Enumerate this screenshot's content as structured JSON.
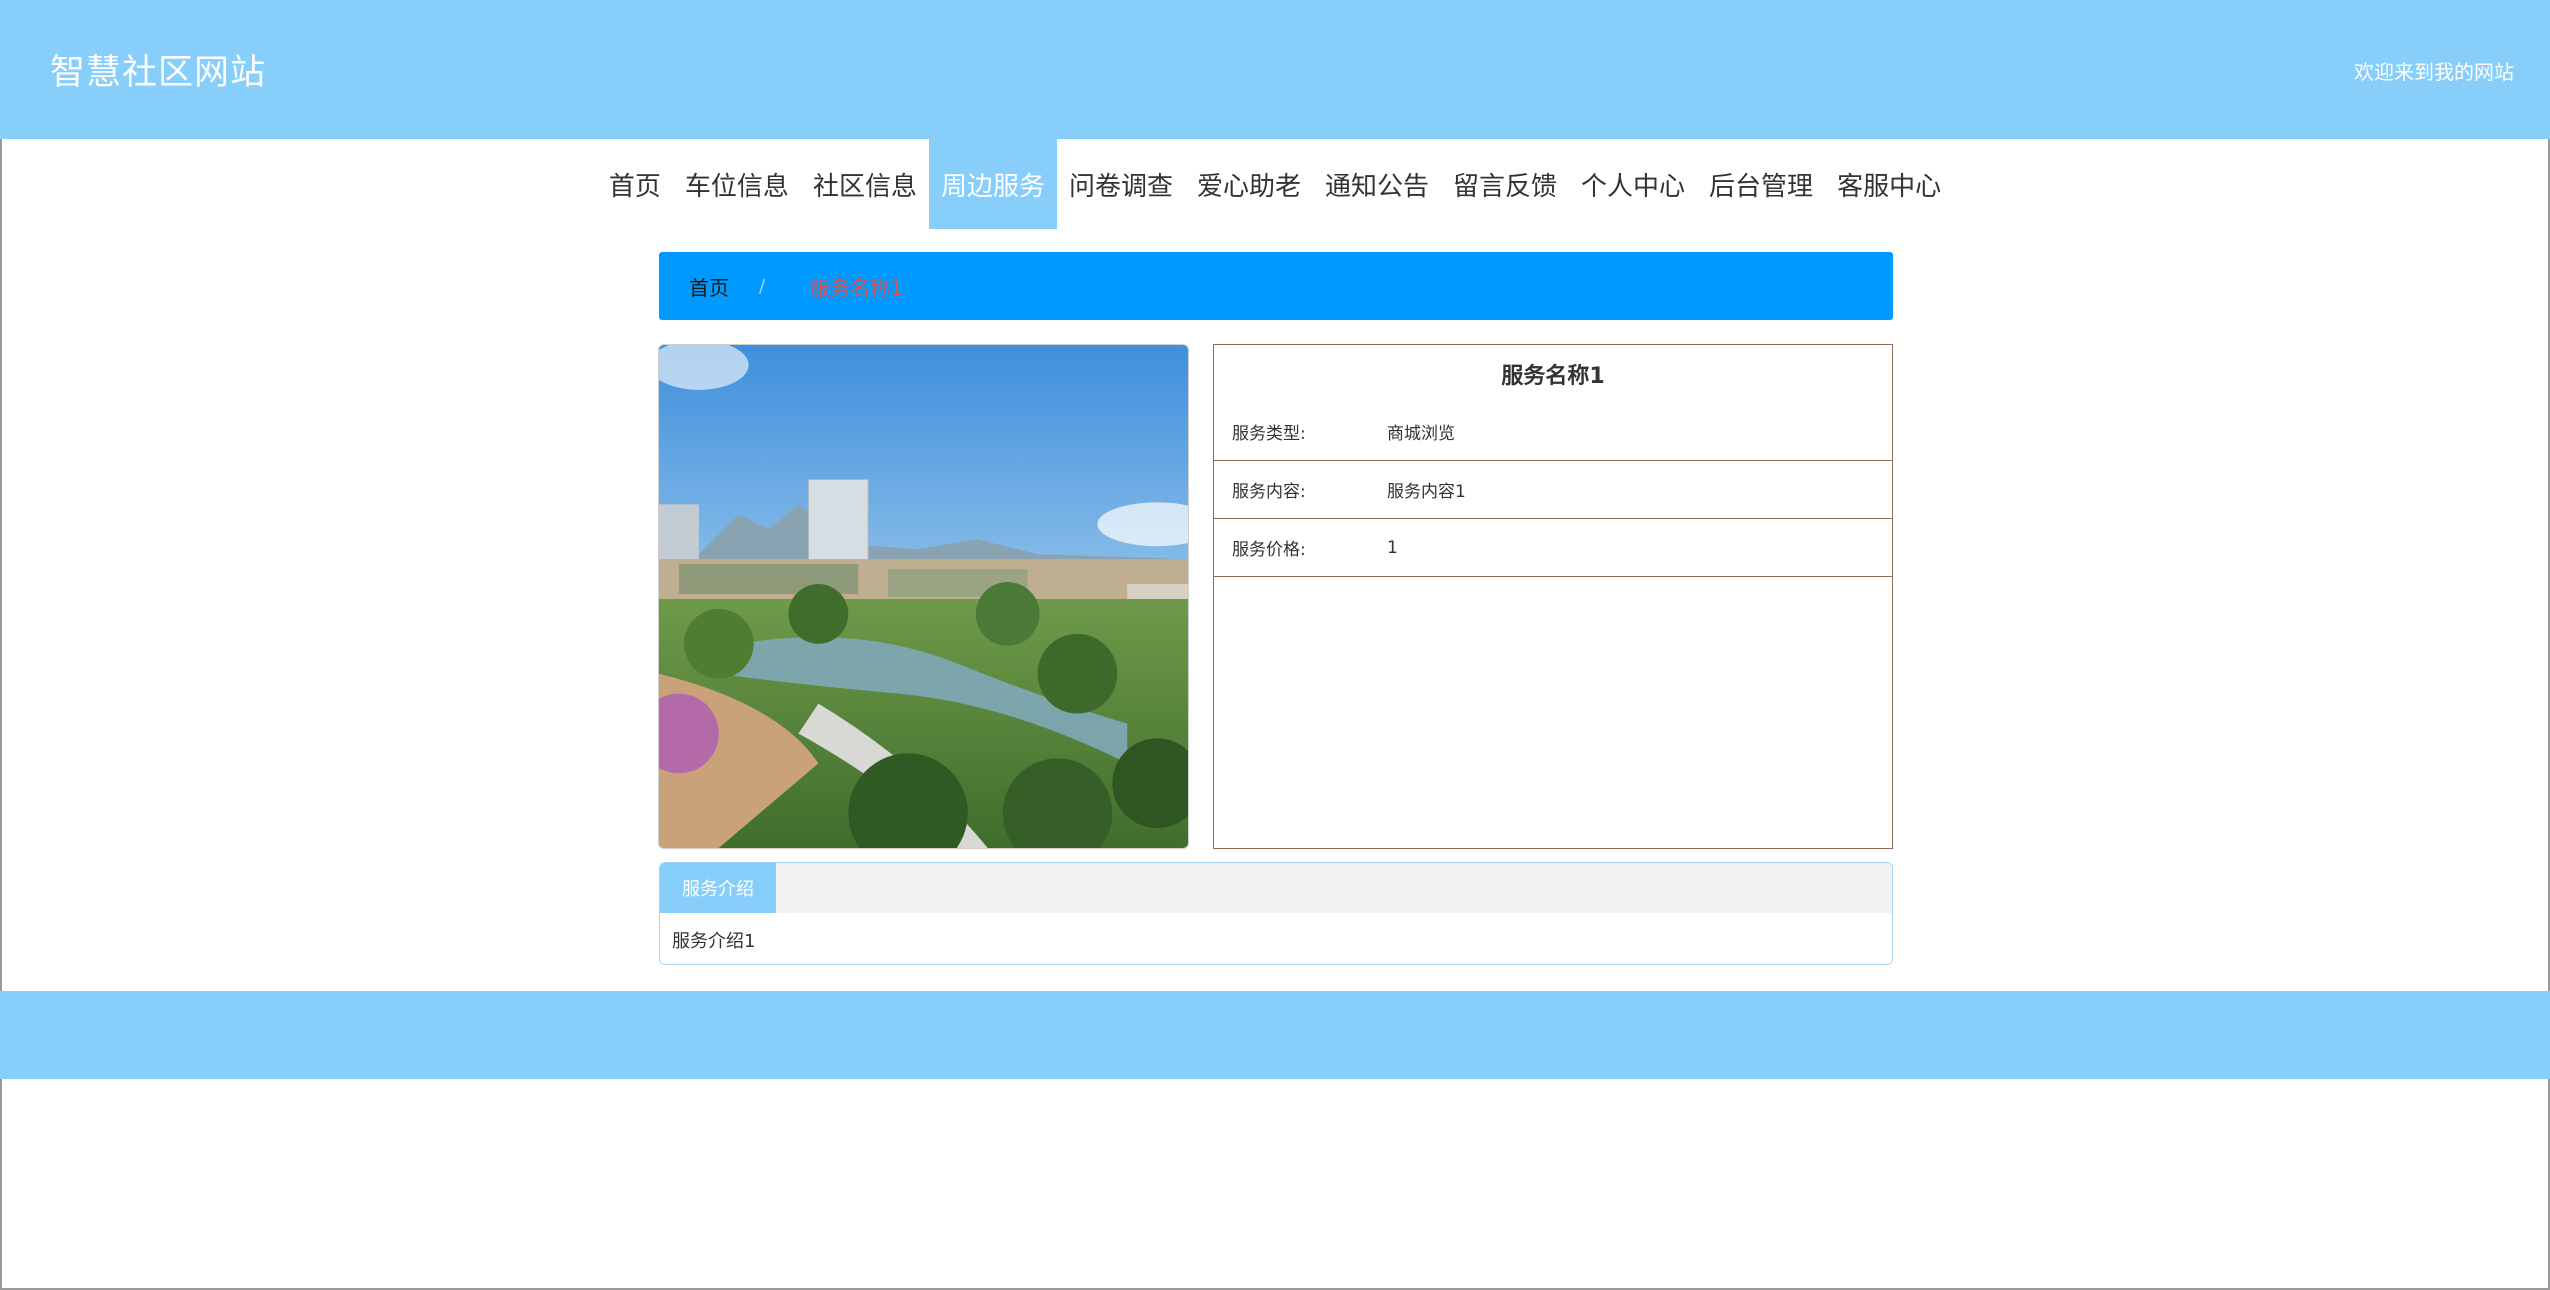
{
  "header": {
    "site_title": "智慧社区网站",
    "welcome": "欢迎来到我的网站"
  },
  "nav": {
    "items": [
      {
        "label": "首页"
      },
      {
        "label": "车位信息"
      },
      {
        "label": "社区信息"
      },
      {
        "label": "周边服务"
      },
      {
        "label": "问卷调查"
      },
      {
        "label": "爱心助老"
      },
      {
        "label": "通知公告"
      },
      {
        "label": "留言反馈"
      },
      {
        "label": "个人中心"
      },
      {
        "label": "后台管理"
      },
      {
        "label": "客服中心"
      }
    ],
    "active_index": 3
  },
  "breadcrumb": {
    "home": "首页",
    "separator": "/",
    "current": "服务名称1"
  },
  "detail": {
    "title": "服务名称1",
    "rows": [
      {
        "label": "服务类型:",
        "value": "商城浏览"
      },
      {
        "label": "服务内容:",
        "value": "服务内容1"
      },
      {
        "label": "服务价格:",
        "value": "1"
      }
    ]
  },
  "tabs": {
    "active_label": "服务介绍",
    "content": "服务介绍1"
  },
  "colors": {
    "header_bg": "#87cefa",
    "breadcrumb_bg": "#0099ff",
    "panel_border": "#8b6d5c",
    "active_nav": "#87cefa"
  }
}
